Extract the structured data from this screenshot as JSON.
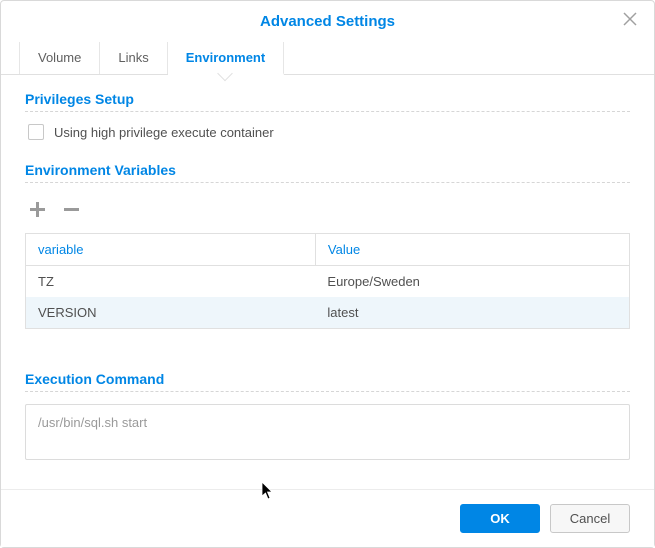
{
  "dialog": {
    "title": "Advanced Settings"
  },
  "tabs": [
    {
      "label": "Volume",
      "active": false
    },
    {
      "label": "Links",
      "active": false
    },
    {
      "label": "Environment",
      "active": true
    }
  ],
  "sections": {
    "privileges": {
      "title": "Privileges Setup",
      "checkbox_label": "Using high privilege execute container"
    },
    "env": {
      "title": "Environment Variables",
      "columns": {
        "var": "variable",
        "val": "Value"
      },
      "rows": [
        {
          "variable": "TZ",
          "value": "Europe/Sweden"
        },
        {
          "variable": "VERSION",
          "value": "latest"
        }
      ]
    },
    "exec": {
      "title": "Execution Command",
      "value": "/usr/bin/sql.sh start"
    }
  },
  "buttons": {
    "ok": "OK",
    "cancel": "Cancel"
  }
}
